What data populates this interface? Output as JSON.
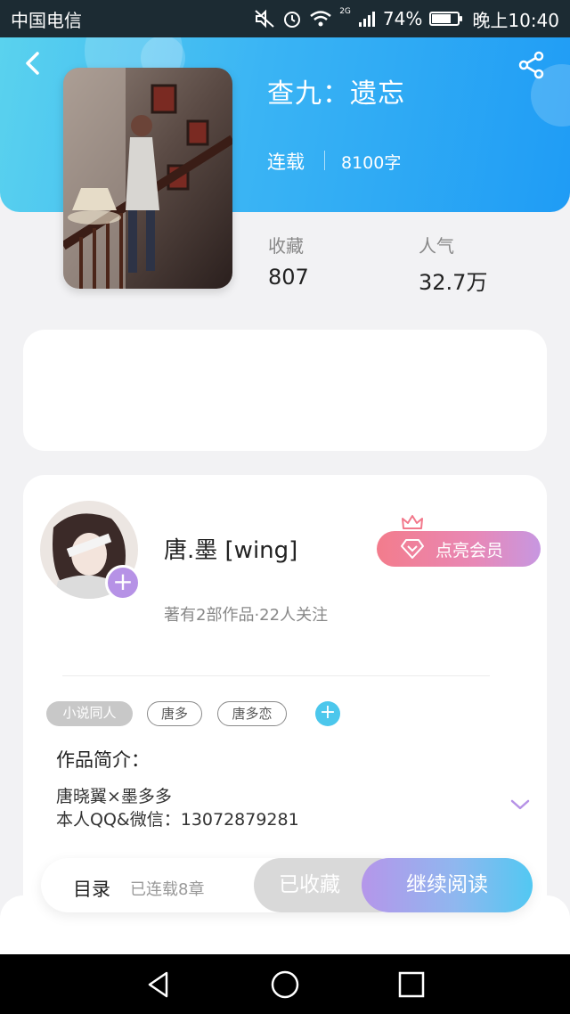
{
  "status_bar": {
    "carrier": "中国电信",
    "network": "2G",
    "battery": "74%",
    "battery_level": 0.74,
    "time": "晚上10:40",
    "icons": [
      "mute-icon",
      "alarm-icon",
      "wifi-icon",
      "signal-icon",
      "battery-icon"
    ]
  },
  "header": {
    "title": "查九：遗忘",
    "status": "连载",
    "word_count": "8100字"
  },
  "stats": {
    "favorites_label": "收藏",
    "favorites_value": "807",
    "popularity_label": "人气",
    "popularity_value": "32.7万"
  },
  "author": {
    "name": "唐.墨 [wing]",
    "meta": "著有2部作品·22人关注",
    "vip_button": "点亮会员"
  },
  "tags": [
    "小说同人",
    "唐多",
    "唐多恋"
  ],
  "intro": {
    "title": "作品简介：",
    "lines": [
      "唐晓翼×墨多多",
      "本人QQ&微信：13072879281"
    ]
  },
  "actions": {
    "toc": "目录",
    "toc_sub": "已连载8章",
    "collected": "已收藏",
    "continue_read": "继续阅读"
  },
  "colors": {
    "header_start": "#5ad2ee",
    "header_end": "#1f9cf5",
    "accent_purple": "#b692e6",
    "vip_pink": "#f37c8c",
    "tag_cyan": "#4cc7ec"
  }
}
